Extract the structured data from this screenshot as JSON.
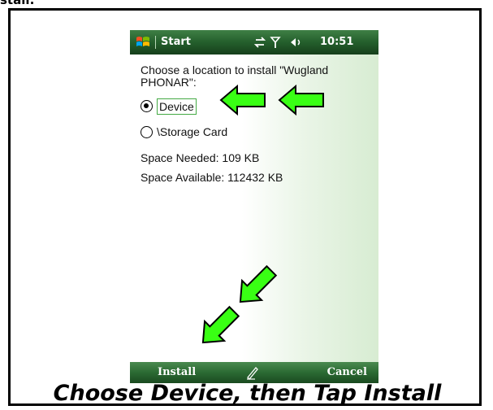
{
  "header_fragment": "stall:",
  "statusbar": {
    "start_label": "Start",
    "time": "10:51"
  },
  "prompt_text": "Choose a location to install \"Wugland PHONAR\":",
  "options": [
    {
      "label": "Device",
      "selected": true
    },
    {
      "label": "\\Storage Card",
      "selected": false
    }
  ],
  "space_needed": "Space Needed:  109 KB",
  "space_available": "Space Available: 112432 KB",
  "menubar": {
    "left": "Install",
    "right": "Cancel"
  },
  "caption": "Choose Device, then Tap Install",
  "colors": {
    "status_green": "#245f2c",
    "arrow_green": "#39ff14",
    "arrow_outline": "#000000"
  },
  "icons": [
    "windows-start-icon",
    "connectivity-icon",
    "signal-icon",
    "volume-icon",
    "sip-pen-icon",
    "arrow-left-icon",
    "arrow-down-left-icon"
  ]
}
